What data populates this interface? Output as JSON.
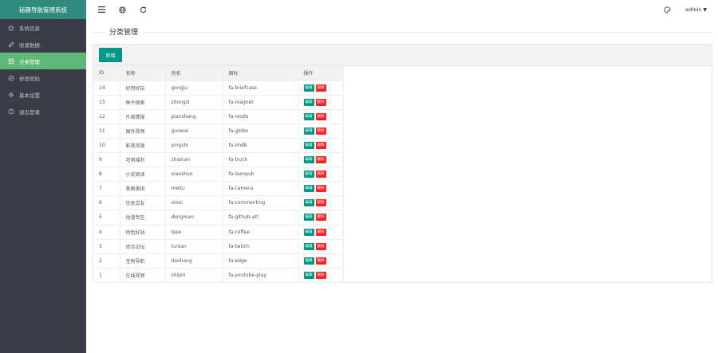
{
  "app": {
    "title": "秘趣导航管理系统"
  },
  "sidebar": {
    "items": [
      {
        "label": "系统信息",
        "icon": "home-icon",
        "active": false
      },
      {
        "label": "收录数据",
        "icon": "link-icon",
        "active": false
      },
      {
        "label": "分类管理",
        "icon": "list-icon",
        "active": true
      },
      {
        "label": "修改密码",
        "icon": "shield-icon",
        "active": false
      },
      {
        "label": "基本设置",
        "icon": "gear-icon",
        "active": false
      },
      {
        "label": "退出登录",
        "icon": "power-icon",
        "active": false
      }
    ]
  },
  "topbar": {
    "user": "admin",
    "icons": [
      "menu-icon",
      "globe-icon",
      "refresh-icon",
      "palette-icon"
    ]
  },
  "main": {
    "section_title": "分类管理",
    "add_button": "新增",
    "columns": [
      "ID",
      "名称",
      "别名",
      "图标",
      "操作"
    ],
    "edit_label": "编辑",
    "delete_label": "删除",
    "rows": [
      {
        "id": "14",
        "name": "好用好玩",
        "alias": "gongju",
        "icon": "fa-briefcase"
      },
      {
        "id": "13",
        "name": "种子搜索",
        "alias": "zhongzi",
        "icon": "fa-magnet"
      },
      {
        "id": "12",
        "name": "片商情报",
        "alias": "pianshang",
        "icon": "fa-modx"
      },
      {
        "id": "11",
        "name": "国外视频",
        "alias": "guowai",
        "icon": "fa-globe"
      },
      {
        "id": "10",
        "name": "影视资源",
        "alias": "yingshi",
        "icon": "fa-imdb"
      },
      {
        "id": "9",
        "name": "宅男福利",
        "alias": "zhainan",
        "icon": "fa-truck"
      },
      {
        "id": "8",
        "name": "小说阅读",
        "alias": "xiaoshuo",
        "icon": "fa-leanpub"
      },
      {
        "id": "7",
        "name": "美图美拍",
        "alias": "meitu",
        "icon": "fa-camera"
      },
      {
        "id": "6",
        "name": "信息交友",
        "alias": "xinxi",
        "icon": "fa-commenting"
      },
      {
        "id": "5",
        "name": "动漫专区",
        "alias": "dongman",
        "icon": "fa-github-alt"
      },
      {
        "id": "4",
        "name": "特色好站",
        "alias": "tese",
        "icon": "fa-coffee"
      },
      {
        "id": "3",
        "name": "综合论坛",
        "alias": "luntan",
        "icon": "fa-twitch"
      },
      {
        "id": "2",
        "name": "宝男导航",
        "alias": "daohang",
        "icon": "fa-edge"
      },
      {
        "id": "1",
        "name": "在线视频",
        "alias": "shipin",
        "icon": "fa-youtube-play"
      }
    ]
  },
  "colors": {
    "brand": "#2f8c7e",
    "active": "#5fb878",
    "sidebar": "#393d49",
    "primary": "#009688",
    "danger": "#ff1f1f"
  }
}
